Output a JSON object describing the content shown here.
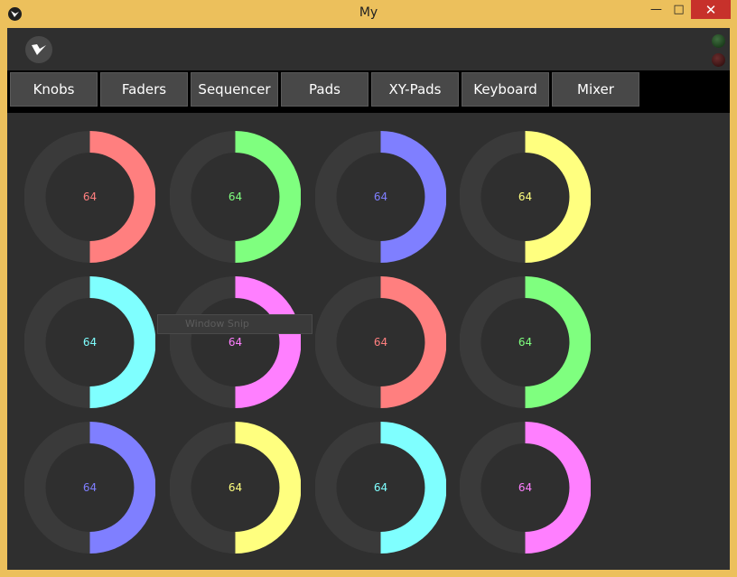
{
  "window": {
    "title": "My",
    "icons": {
      "app": "kivy-logo-icon",
      "minimize": "minimize-icon",
      "maximize": "maximize-icon",
      "close": "close-icon"
    }
  },
  "header": {
    "logo_icon": "kivy-logo-icon"
  },
  "tabs": [
    {
      "label": "Knobs",
      "active": true
    },
    {
      "label": "Faders",
      "active": false
    },
    {
      "label": "Sequencer",
      "active": false
    },
    {
      "label": "Pads",
      "active": false
    },
    {
      "label": "XY-Pads",
      "active": false
    },
    {
      "label": "Keyboard",
      "active": false
    },
    {
      "label": "Mixer",
      "active": false
    }
  ],
  "knobs": [
    {
      "value": "64",
      "level": 0.5,
      "color": "#ff7f7f"
    },
    {
      "value": "64",
      "level": 0.5,
      "color": "#7fff7f"
    },
    {
      "value": "64",
      "level": 0.5,
      "color": "#7f7fff"
    },
    {
      "value": "64",
      "level": 0.5,
      "color": "#ffff7f"
    },
    {
      "value": "64",
      "level": 0.5,
      "color": "#7fffff"
    },
    {
      "value": "64",
      "level": 0.5,
      "color": "#ff7fff"
    },
    {
      "value": "64",
      "level": 0.5,
      "color": "#ff7f7f"
    },
    {
      "value": "64",
      "level": 0.5,
      "color": "#7fff7f"
    },
    {
      "value": "64",
      "level": 0.5,
      "color": "#7f7fff"
    },
    {
      "value": "64",
      "level": 0.5,
      "color": "#ffff7f"
    },
    {
      "value": "64",
      "level": 0.5,
      "color": "#7fffff"
    },
    {
      "value": "64",
      "level": 0.5,
      "color": "#ff7fff"
    }
  ],
  "overlay": {
    "text": "Window Snip"
  },
  "colors": {
    "track": "#3a3a3a",
    "panel": "#2f2f2f",
    "tab_accent": "#2f7fc1"
  }
}
